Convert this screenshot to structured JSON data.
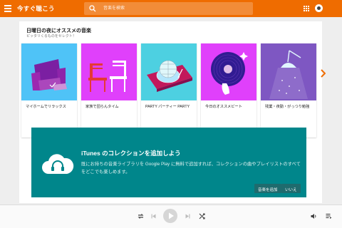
{
  "header": {
    "app_title": "今すぐ聴こう",
    "search_placeholder": "音楽を検索"
  },
  "section": {
    "title": "日曜日の夜にオススメの音楽",
    "subtitle": "ピッタリくるものをセレクト！"
  },
  "tiles": [
    {
      "label": "マイホームでリラックス",
      "color": "#4fc3f7"
    },
    {
      "label": "家族で団らんタイム",
      "color": "#e040fb"
    },
    {
      "label": "PARTY パーティー PARTY",
      "color": "#4dd0e1"
    },
    {
      "label": "今日のオススメビート",
      "color": "#e040fb"
    },
    {
      "label": "残業・夜勤・がっつり勉強",
      "color": "#7e57c2"
    }
  ],
  "banner": {
    "title": "iTunes のコレクションを追加しよう",
    "body": "既にお持ちの音楽ライブラリを Google Play に無料で追加すれば、コレクションの曲やプレイリストのすべてをどこでも楽しめます。",
    "add_label": "音楽を追加",
    "no_label": "いいえ"
  },
  "colors": {
    "accent": "#ef6c00",
    "banner": "#00868b"
  }
}
